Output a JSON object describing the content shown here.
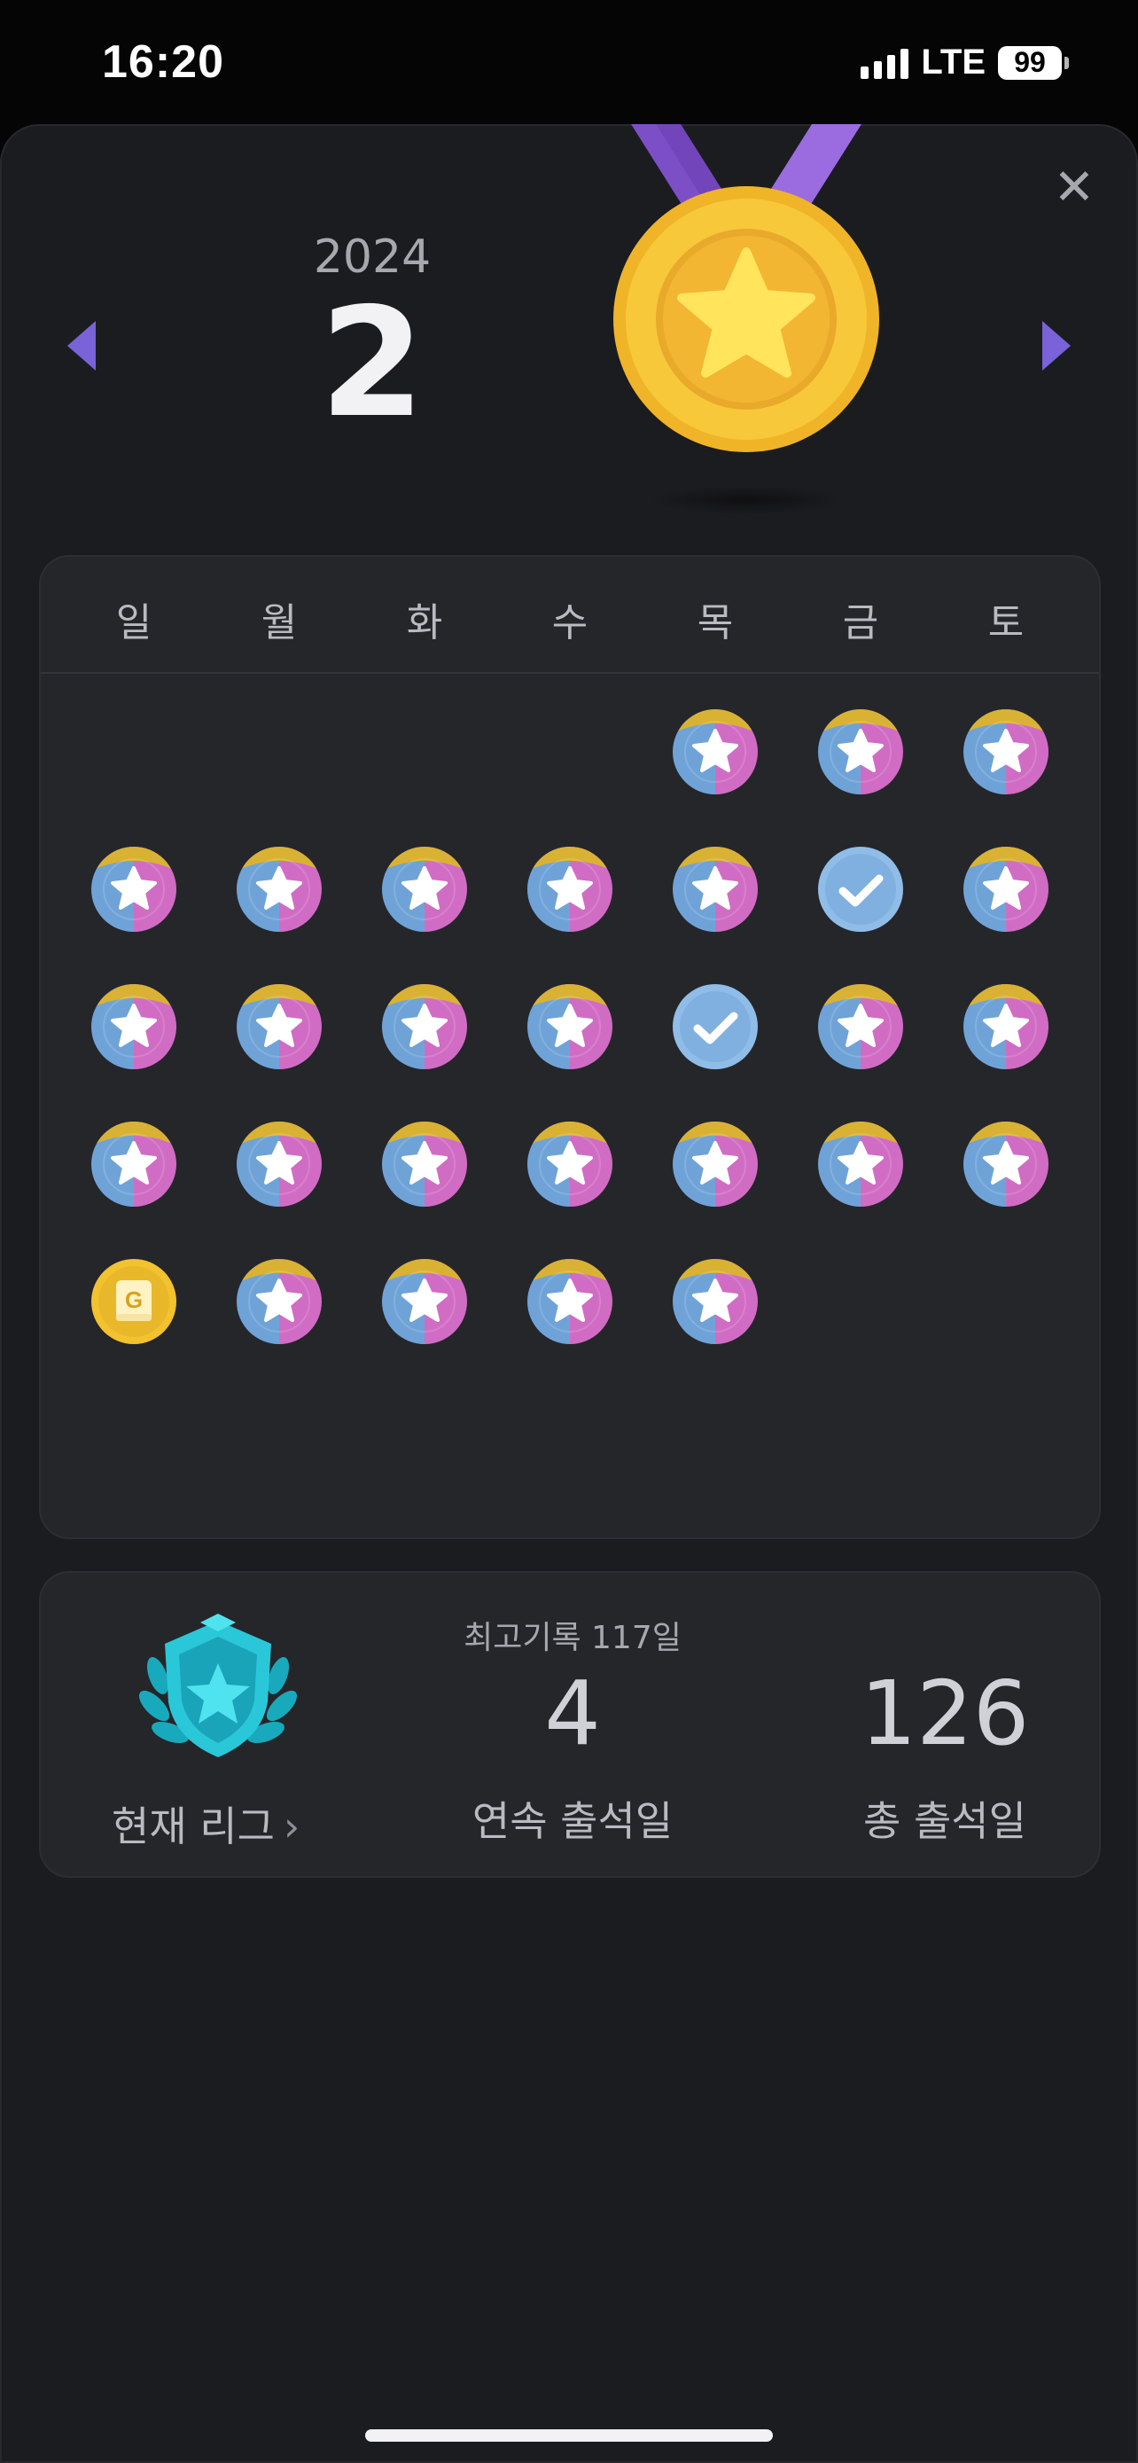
{
  "status_bar": {
    "time": "16:20",
    "network": "LTE",
    "battery": "99"
  },
  "header": {
    "year": "2024",
    "month": "2"
  },
  "calendar": {
    "weekdays": [
      "일",
      "월",
      "화",
      "수",
      "목",
      "금",
      "토"
    ],
    "days": [
      "",
      "",
      "",
      "",
      "star",
      "star",
      "star",
      "star",
      "star",
      "star",
      "star",
      "star",
      "check",
      "star",
      "star",
      "star",
      "star",
      "star",
      "check",
      "star",
      "star",
      "star",
      "star",
      "star",
      "star",
      "star",
      "star",
      "star",
      "gold-g",
      "star",
      "star",
      "star",
      "star",
      "",
      ""
    ]
  },
  "stats": {
    "league_label": "현재 리그",
    "best_record": "최고기록 117일",
    "streak_value": "4",
    "streak_label": "연속 출석일",
    "total_value": "126",
    "total_label": "총 출석일"
  },
  "icons": {
    "close": "close-icon",
    "prev": "triangle-left-icon",
    "next": "triangle-right-icon",
    "medal": "gold-medal-star-icon",
    "league": "cyan-shield-star-badge-icon"
  },
  "colors": {
    "accent": "#7a63d8",
    "gold": "#f3c23a",
    "check": "#8fbde8",
    "league": "#2ac7d9"
  }
}
